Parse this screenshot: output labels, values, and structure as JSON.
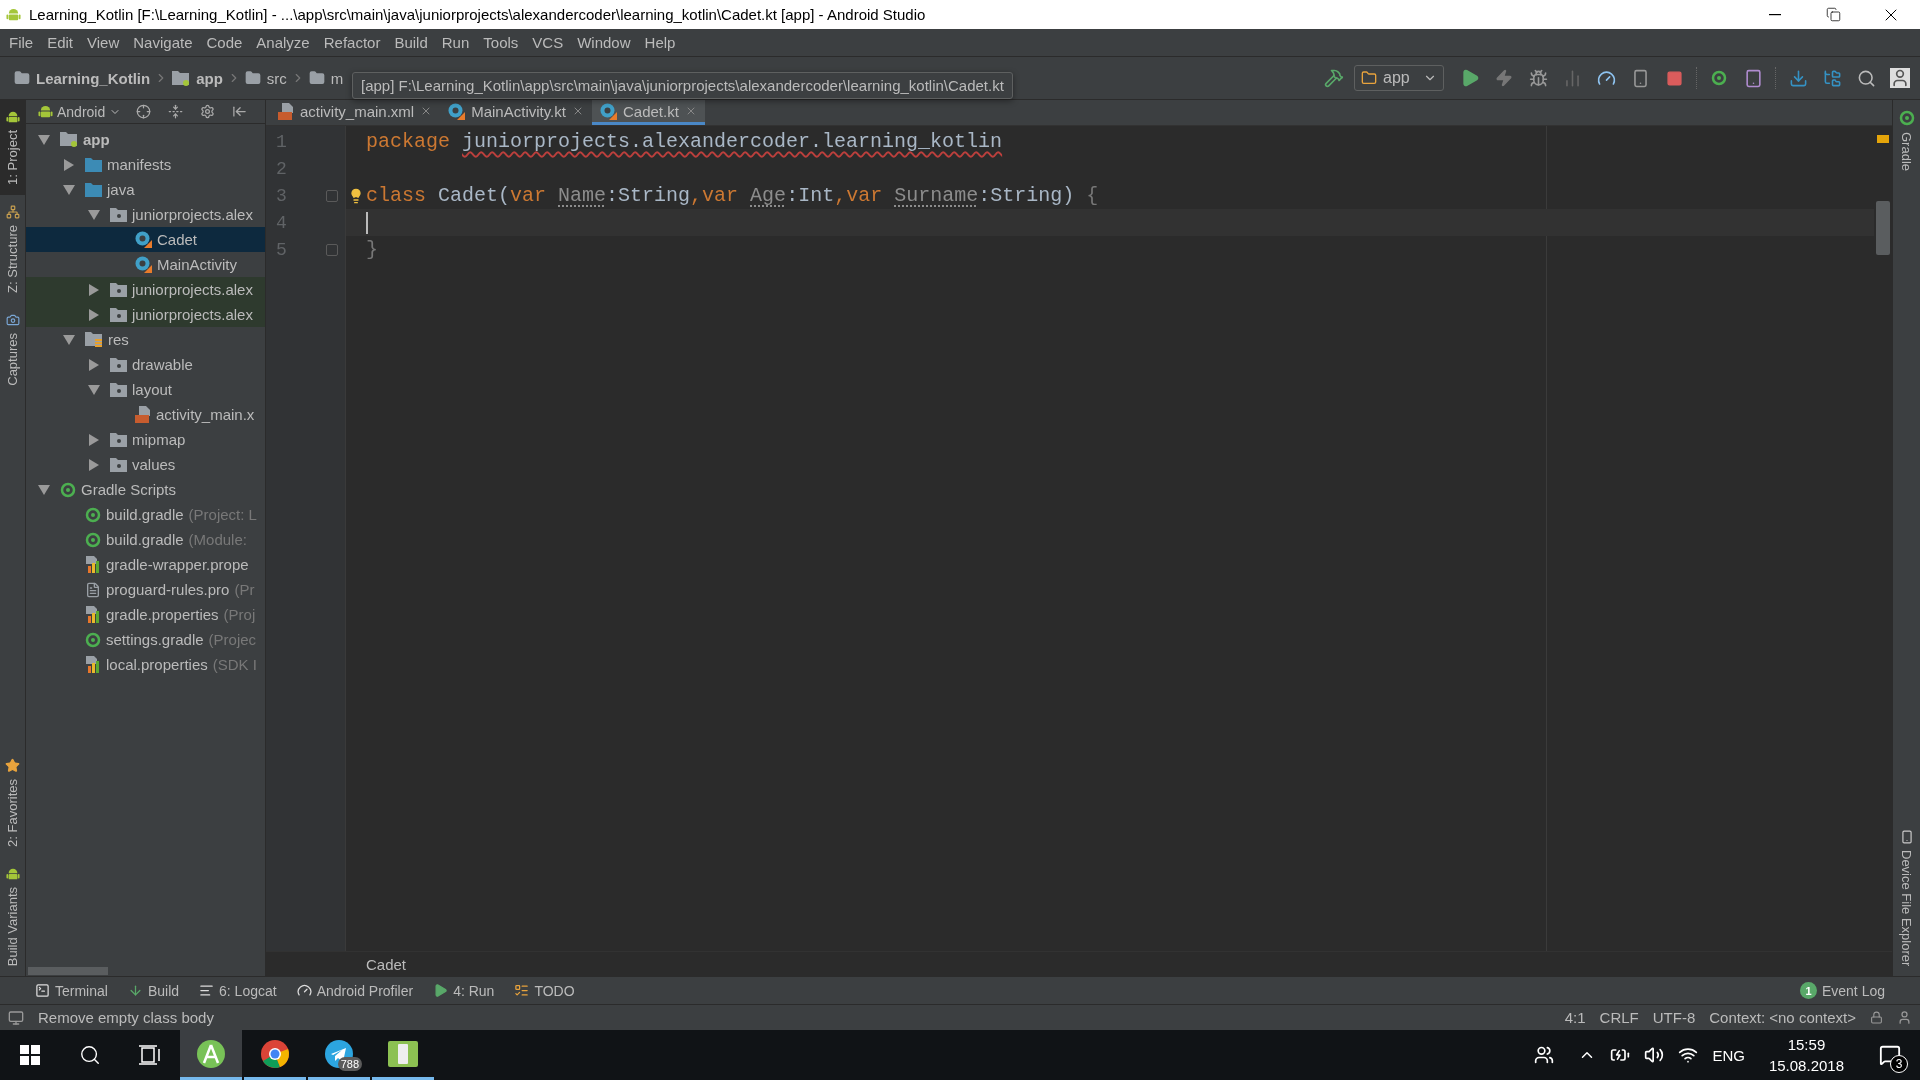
{
  "window": {
    "title": "Learning_Kotlin [F:\\Learning_Kotlin] - ...\\app\\src\\main\\java\\juniorprojects\\alexandercoder\\learning_kotlin\\Cadet.kt [app] - Android Studio"
  },
  "menu": [
    "File",
    "Edit",
    "View",
    "Navigate",
    "Code",
    "Analyze",
    "Refactor",
    "Build",
    "Run",
    "Tools",
    "VCS",
    "Window",
    "Help"
  ],
  "breadcrumbs": [
    {
      "label": "Learning_Kotlin",
      "kind": "project"
    },
    {
      "label": "app",
      "kind": "module"
    },
    {
      "label": "src",
      "kind": "folder"
    },
    {
      "label": "m",
      "kind": "folder"
    }
  ],
  "tooltip": "[app] F:\\Learning_Kotlin\\app\\src\\main\\java\\juniorprojects\\alexandercoder\\learning_kotlin\\Cadet.kt",
  "run_config": "app",
  "left_tools_top": [
    {
      "label": "1: Project",
      "kind": "android",
      "selected": true
    },
    {
      "label": "Z: Structure",
      "kind": "structure",
      "selected": false
    },
    {
      "label": "Captures",
      "kind": "captures",
      "selected": false
    }
  ],
  "left_tools_bottom": [
    {
      "label": "2: Favorites",
      "kind": "star",
      "selected": false
    },
    {
      "label": "Build Variants",
      "kind": "android",
      "selected": false
    }
  ],
  "project_panel": {
    "view": "Android",
    "tree": [
      {
        "label": "app",
        "kind": "module",
        "expanded": true,
        "selected": false,
        "children": [
          {
            "label": "manifests",
            "kind": "folder",
            "expanded": false,
            "selected": false
          },
          {
            "label": "java",
            "kind": "folder",
            "expanded": true,
            "selected": false,
            "children": [
              {
                "label": "juniorprojects.alex",
                "kind": "package",
                "expanded": true,
                "selected": false,
                "children": [
                  {
                    "label": "Cadet",
                    "kind": "kotlin",
                    "selected": true
                  },
                  {
                    "label": "MainActivity",
                    "kind": "kotlin",
                    "selected": false
                  }
                ]
              },
              {
                "label": "juniorprojects.alex",
                "kind": "test-package",
                "expanded": false,
                "selected": false
              },
              {
                "label": "juniorprojects.alex",
                "kind": "test-package",
                "expanded": false,
                "selected": false
              }
            ]
          },
          {
            "label": "res",
            "kind": "res",
            "expanded": true,
            "selected": false,
            "children": [
              {
                "label": "drawable",
                "kind": "package",
                "expanded": false,
                "selected": false
              },
              {
                "label": "layout",
                "kind": "package",
                "expanded": true,
                "selected": false,
                "children": [
                  {
                    "label": "activity_main.x",
                    "kind": "xml",
                    "selected": false
                  }
                ]
              },
              {
                "label": "mipmap",
                "kind": "package",
                "expanded": false,
                "selected": false
              },
              {
                "label": "values",
                "kind": "package",
                "expanded": false,
                "selected": false
              }
            ]
          }
        ]
      },
      {
        "label": "Gradle Scripts",
        "kind": "gradle",
        "expanded": true,
        "selected": false,
        "children": [
          {
            "label": "build.gradle",
            "hint": "(Project: L",
            "kind": "gradle",
            "selected": false
          },
          {
            "label": "build.gradle",
            "hint": "(Module:",
            "kind": "gradle",
            "selected": false
          },
          {
            "label": "gradle-wrapper.prope",
            "kind": "props",
            "selected": false
          },
          {
            "label": "proguard-rules.pro",
            "hint": "(Pr",
            "kind": "file",
            "selected": false
          },
          {
            "label": "gradle.properties",
            "hint": "(Proj",
            "kind": "props",
            "selected": false
          },
          {
            "label": "settings.gradle",
            "hint": "(Projec",
            "kind": "gradle",
            "selected": false
          },
          {
            "label": "local.properties",
            "hint": "(SDK I",
            "kind": "props",
            "selected": false
          }
        ]
      }
    ]
  },
  "editor_tabs": [
    {
      "label": "activity_main.xml",
      "kind": "xml",
      "selected": false
    },
    {
      "label": "MainActivity.kt",
      "kind": "kotlin",
      "selected": false
    },
    {
      "label": "Cadet.kt",
      "kind": "kotlin",
      "selected": true
    }
  ],
  "code": {
    "lines": [
      {
        "number": "1",
        "current": false,
        "fold": false,
        "intention": false,
        "tokens": [
          {
            "kind": "keyword",
            "text": "package "
          },
          {
            "kind": "package-name",
            "text": "juniorprojects.alexandercoder.learning_kotlin"
          }
        ]
      },
      {
        "number": "2",
        "current": false,
        "fold": false,
        "intention": false
      },
      {
        "number": "3",
        "current": false,
        "fold": true,
        "intention": true,
        "tokens": [
          {
            "kind": "keyword",
            "text": "class "
          },
          {
            "kind": "plain",
            "text": "Cadet("
          },
          {
            "kind": "keyword",
            "text": "var "
          },
          {
            "kind": "param",
            "text": "Name"
          },
          {
            "kind": "plain",
            "text": ":String"
          },
          {
            "kind": "keyword",
            "text": ","
          },
          {
            "kind": "keyword",
            "text": "var "
          },
          {
            "kind": "param",
            "text": "Age"
          },
          {
            "kind": "plain",
            "text": ":Int"
          },
          {
            "kind": "keyword",
            "text": ","
          },
          {
            "kind": "keyword",
            "text": "var "
          },
          {
            "kind": "param",
            "text": "Surname"
          },
          {
            "kind": "plain",
            "text": ":String) "
          },
          {
            "kind": "brace",
            "text": "{"
          }
        ]
      },
      {
        "number": "4",
        "current": true,
        "fold": false,
        "intention": false
      },
      {
        "number": "5",
        "current": false,
        "fold": true,
        "intention": false,
        "tokens": [
          {
            "kind": "brace",
            "text": "}"
          }
        ]
      }
    ],
    "breadcrumb": "Cadet"
  },
  "right_tools_top": [
    "Gradle"
  ],
  "right_tools_bottom": [
    "Device File Explorer"
  ],
  "tool_windows": [
    {
      "label": "Terminal",
      "kind": "terminal"
    },
    {
      "label": "Build",
      "kind": "build"
    },
    {
      "label": "6: Logcat",
      "kind": "logcat"
    },
    {
      "label": "Android Profiler",
      "kind": "profiler"
    },
    {
      "label": "4: Run",
      "kind": "run"
    },
    {
      "label": "TODO",
      "kind": "todo"
    }
  ],
  "event_log": {
    "label": "Event Log",
    "count": "1"
  },
  "status": {
    "message": "Remove empty class body",
    "position": "4:1",
    "line_separator": "CRLF",
    "encoding": "UTF-8",
    "context": "Context: <no context>"
  },
  "taskbar": {
    "apps": [
      {
        "kind": "android-studio",
        "active": true
      },
      {
        "kind": "chrome",
        "active": false
      },
      {
        "kind": "telegram",
        "active": false,
        "badge": "788"
      },
      {
        "kind": "device",
        "active": false
      }
    ],
    "language": "ENG",
    "time": "15:59",
    "date": "15.08.2018",
    "notifications": "3"
  }
}
